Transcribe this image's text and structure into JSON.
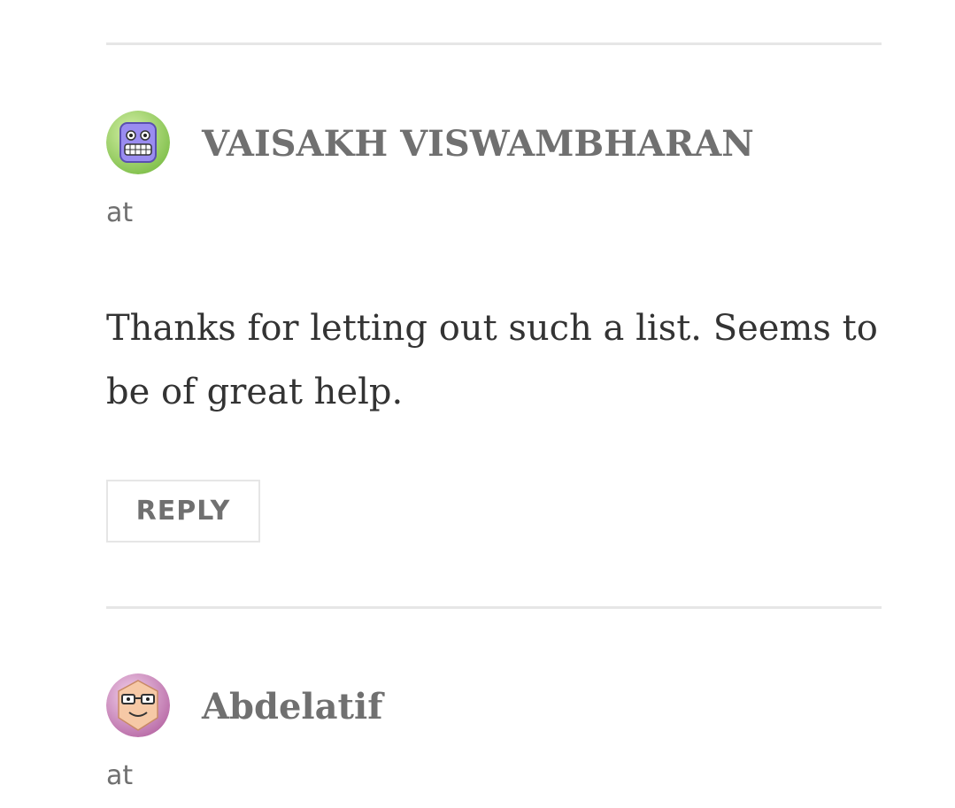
{
  "comments": [
    {
      "author": "VAISAKH VISWAMBHARAN",
      "meta": "at",
      "text": "Thanks for letting out such a list. Seems to be of great help.",
      "reply_label": "REPLY",
      "avatar_icon": "grinning-robot-avatar-icon"
    },
    {
      "author": "Abdelatif",
      "meta": "at",
      "avatar_icon": "glasses-face-avatar-icon"
    }
  ],
  "colors": {
    "divider": "#e6e6e6",
    "author": "#707070",
    "body_text": "#333333"
  }
}
